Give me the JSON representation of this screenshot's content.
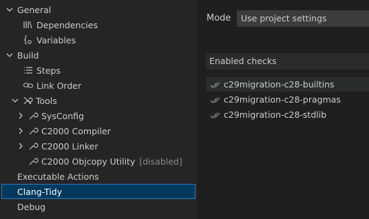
{
  "sidebar": {
    "items": [
      {
        "label": "General",
        "icon": "chevron-down-icon"
      },
      {
        "label": "Dependencies",
        "icon": "library-icon"
      },
      {
        "label": "Variables",
        "icon": "braces-variable-icon"
      },
      {
        "label": "Build",
        "icon": "chevron-down-icon"
      },
      {
        "label": "Steps",
        "icon": "list-icon"
      },
      {
        "label": "Link Order",
        "icon": "link-icon"
      },
      {
        "label": "Tools",
        "icon": "tools-icon"
      },
      {
        "label": "SysConfig",
        "icon": "wrench-icon"
      },
      {
        "label": "C2000 Compiler",
        "icon": "wrench-icon"
      },
      {
        "label": "C2000 Linker",
        "icon": "wrench-icon"
      },
      {
        "label": "C2000 Objcopy Utility",
        "icon": "wrench-icon",
        "badge": "[disabled]"
      },
      {
        "label": "Executable Actions"
      },
      {
        "label": "Clang-Tidy",
        "selected": true
      },
      {
        "label": "Debug"
      }
    ]
  },
  "main": {
    "mode_label": "Mode",
    "mode_value": "Use project settings",
    "checks_header": "Enabled checks",
    "checks": [
      {
        "label": "c29migration-c28-builtins"
      },
      {
        "label": "c29migration-c28-pragmas"
      },
      {
        "label": "c29migration-c28-stdlib"
      }
    ]
  },
  "colors": {
    "selection_bg": "#04395e",
    "selection_border": "#2b7bbf",
    "sidebar_bg": "#252526",
    "editor_bg": "#1f1f1f"
  }
}
